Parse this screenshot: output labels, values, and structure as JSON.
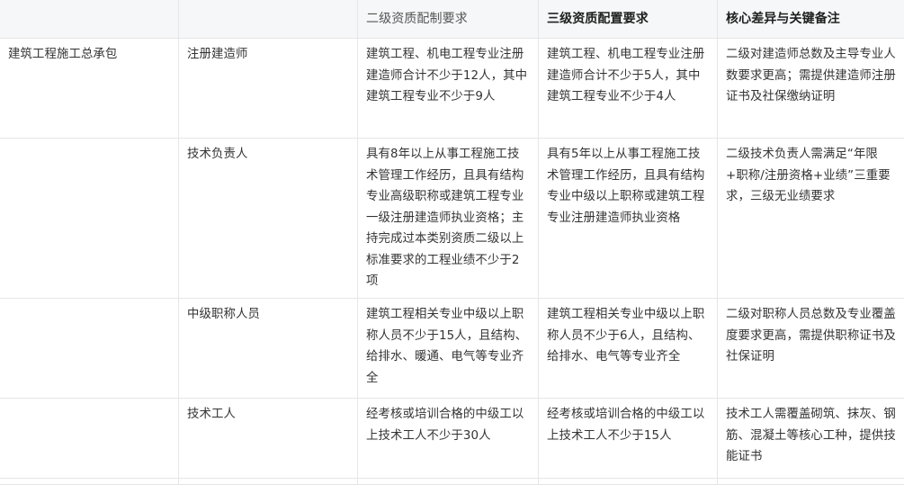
{
  "table": {
    "headers": [
      "",
      "",
      "二级资质配制要求",
      "三级资质配置要求",
      "核心差异与关键备注"
    ],
    "category": "建筑工程施工总承包",
    "rows": [
      {
        "role": "注册建造师",
        "level2": "建筑工程、机电工程专业注册建造师合计不少于12人，其中建筑工程专业不少于9人",
        "level3": "建筑工程、机电工程专业注册建造师合计不少于5人，其中建筑工程专业不少于4人",
        "note": "二级对建造师总数及主导专业人数要求更高；需提供建造师注册证书及社保缴纳证明"
      },
      {
        "role": "技术负责人",
        "level2": "具有8年以上从事工程施工技术管理工作经历，且具有结构专业高级职称或建筑工程专业一级注册建造师执业资格；主持完成过本类别资质二级以上标准要求的工程业绩不少于2项",
        "level3": "具有5年以上从事工程施工技术管理工作经历，且具有结构专业中级以上职称或建筑工程专业注册建造师执业资格",
        "note": "二级技术负责人需满足“年限+职称/注册资格+业绩”三重要求，三级无业绩要求"
      },
      {
        "role": "中级职称人员",
        "level2": "建筑工程相关专业中级以上职称人员不少于15人，且结构、给排水、暖通、电气等专业齐全",
        "level3": "建筑工程相关专业中级以上职称人员不少于6人，且结构、给排水、电气等专业齐全",
        "note": "二级对职称人员总数及专业覆盖度要求更高，需提供职称证书及社保证明"
      },
      {
        "role": "技术工人",
        "level2": "经考核或培训合格的中级工以上技术工人不少于30人",
        "level3": "经考核或培训合格的中级工以上技术工人不少于15人",
        "note": "技术工人需覆盖砌筑、抹灰、钢筋、混凝土等核心工种，提供技能证书"
      }
    ]
  }
}
